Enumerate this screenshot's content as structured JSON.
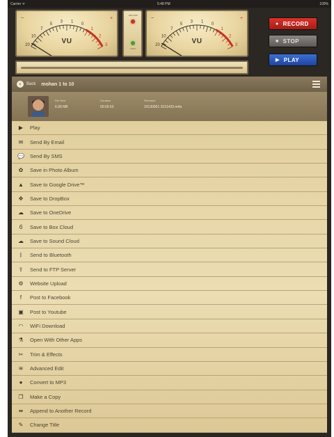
{
  "status_bar": {
    "carrier": "Carrier ᯤ",
    "time": "5:48 PM",
    "battery": "100%"
  },
  "meters": {
    "left_label": "VU",
    "right_label": "VU",
    "scale_marks": [
      "20",
      "10",
      "7",
      "5",
      "3",
      "1",
      "0",
      "1",
      "2",
      "3"
    ],
    "minus_sign": "−",
    "plus_sign": "+",
    "center_top_caption": "RECORD",
    "center_bottom_caption": "PEAK"
  },
  "playback_progress": 0.0,
  "transport": {
    "record_label": "RECORD",
    "stop_label": "STOP",
    "play_label": "PLAY",
    "record_color": "#d9332a",
    "stop_color": "#6d6a66",
    "play_color": "#2d58bb"
  },
  "nav": {
    "back_label": "Back",
    "title": "mohan 1 to 10"
  },
  "file_info": {
    "size_header": "File Size",
    "size_value": "6.08 MB",
    "duration_header": "Duration",
    "duration_value": "00:06:53",
    "filename_header": "Filename",
    "filename_value": "20130901 2031420.m4a"
  },
  "menu": [
    {
      "icon": "play-icon",
      "glyph": "▶",
      "label": "Play"
    },
    {
      "icon": "email-icon",
      "glyph": "✉",
      "label": "Send By Email"
    },
    {
      "icon": "sms-icon",
      "glyph": "💬",
      "label": "Send By SMS"
    },
    {
      "icon": "photo-album-icon",
      "glyph": "✿",
      "label": "Save in Photo Album"
    },
    {
      "icon": "google-drive-icon",
      "glyph": "▲",
      "label": "Save to Google Drive™"
    },
    {
      "icon": "dropbox-icon",
      "glyph": "✥",
      "label": "Save to DropBox"
    },
    {
      "icon": "onedrive-icon",
      "glyph": "☁",
      "label": "Save to OneDrive"
    },
    {
      "icon": "box-cloud-icon",
      "glyph": "б",
      "label": "Save to Box Cloud"
    },
    {
      "icon": "soundcloud-icon",
      "glyph": "☁",
      "label": "Save to Sound Cloud"
    },
    {
      "icon": "bluetooth-icon",
      "glyph": "ᛒ",
      "label": "Send to Bluetooth"
    },
    {
      "icon": "ftp-icon",
      "glyph": "⇪",
      "label": "Send to FTP Server"
    },
    {
      "icon": "upload-icon",
      "glyph": "⚙",
      "label": "Website Upload"
    },
    {
      "icon": "facebook-icon",
      "glyph": "f",
      "label": "Post to Facebook"
    },
    {
      "icon": "youtube-icon",
      "glyph": "▣",
      "label": "Post to Youtube"
    },
    {
      "icon": "wifi-icon",
      "glyph": "◠",
      "label": "WiFi Download"
    },
    {
      "icon": "open-with-icon",
      "glyph": "⚗",
      "label": "Open With Other Apps"
    },
    {
      "icon": "trim-icon",
      "glyph": "✂",
      "label": "Trim & Effects"
    },
    {
      "icon": "advanced-edit-icon",
      "glyph": "≋",
      "label": "Advanced Edit"
    },
    {
      "icon": "convert-icon",
      "glyph": "●",
      "label": "Convert to MP3"
    },
    {
      "icon": "copy-icon",
      "glyph": "❐",
      "label": "Make a Copy"
    },
    {
      "icon": "append-icon",
      "glyph": "⇹",
      "label": "Append to Another Record"
    },
    {
      "icon": "edit-title-icon",
      "glyph": "✎",
      "label": "Change Title"
    }
  ]
}
